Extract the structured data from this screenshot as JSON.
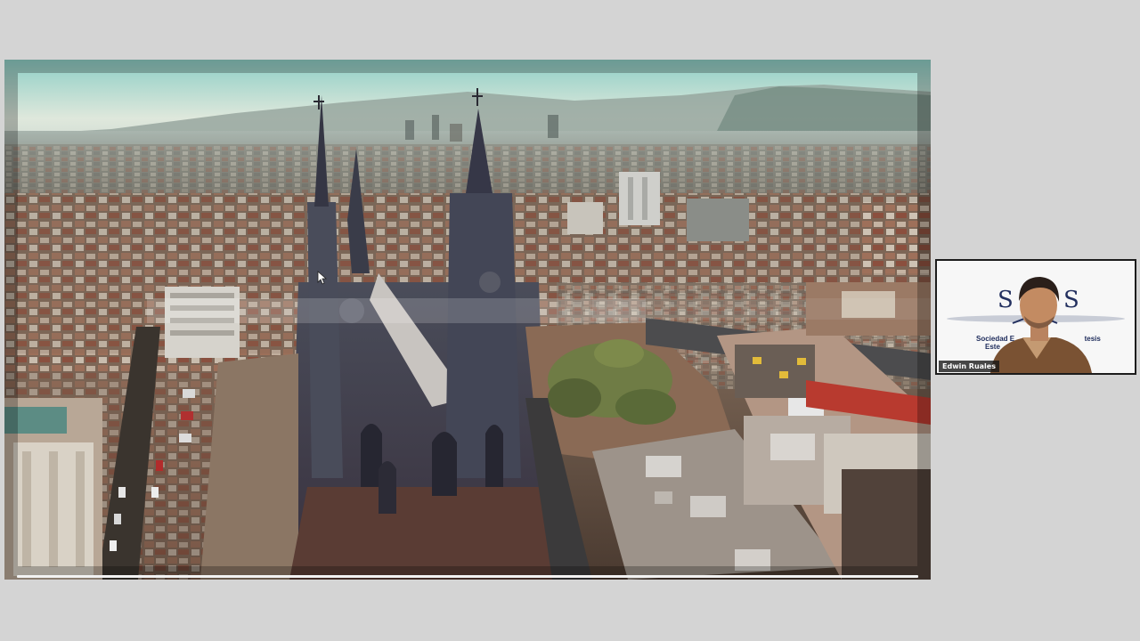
{
  "meeting": {
    "participant": {
      "name": "Edwin Ruales",
      "background_line1": "Sociedad E",
      "background_line1_tail": "tesis",
      "background_line2": "Este"
    }
  },
  "colors": {
    "page_background": "#d4d4d4",
    "tile_border": "#1c1c1c",
    "name_label_background": "#141414"
  }
}
